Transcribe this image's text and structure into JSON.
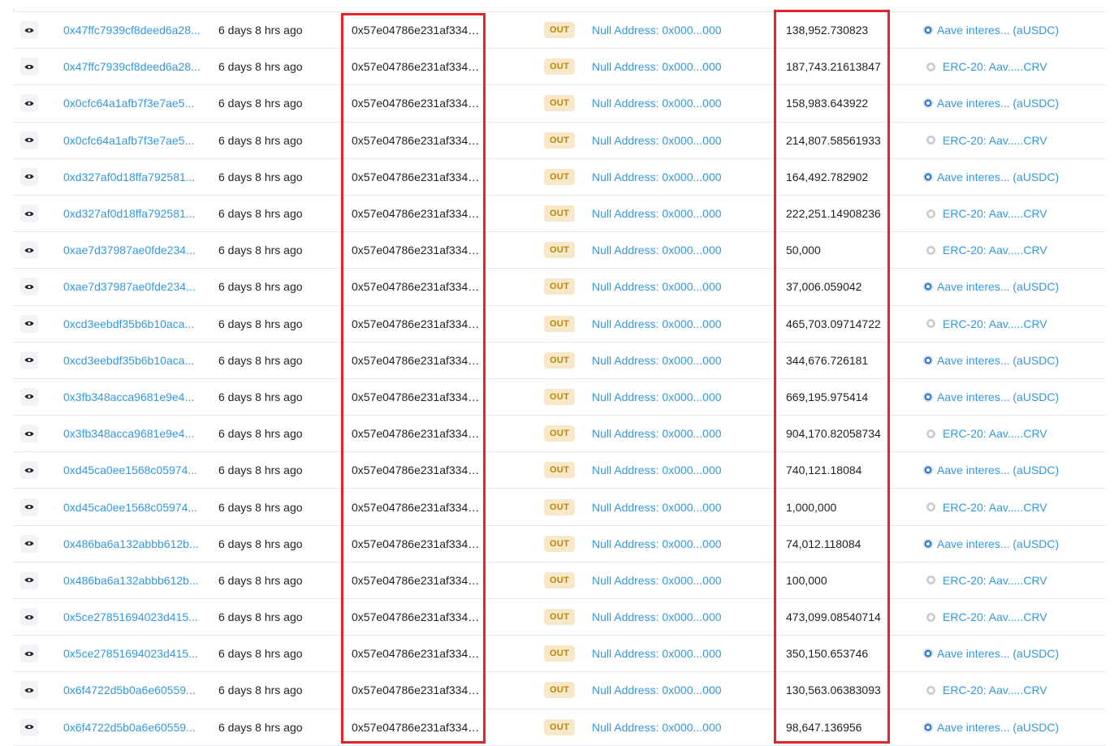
{
  "colors": {
    "link": "#3498db",
    "badge_bg": "#f8e8c8",
    "badge_text": "#b8860b",
    "highlight": "#e3242b",
    "row_border": "#e7eaf3"
  },
  "icons": {
    "view": "eye-icon",
    "token_ausdc": "ausdc-token-icon",
    "token_crv": "crv-token-icon"
  },
  "rows": [
    {
      "txn_hash": "0x47ffc7939cf8deed6a28...",
      "age": "6 days 8 hrs ago",
      "from": "0x57e04786e231af3343...",
      "direction": "OUT",
      "to": "Null Address: 0x000...000",
      "value": "138,952.730823",
      "token_type": "ausdc",
      "token": "Aave interes... (aUSDC)"
    },
    {
      "txn_hash": "0x47ffc7939cf8deed6a28...",
      "age": "6 days 8 hrs ago",
      "from": "0x57e04786e231af3343...",
      "direction": "OUT",
      "to": "Null Address: 0x000...000",
      "value": "187,743.21613847",
      "token_type": "crv",
      "token": "ERC-20: Aav.....CRV"
    },
    {
      "txn_hash": "0x0cfc64a1afb7f3e7ae5...",
      "age": "6 days 8 hrs ago",
      "from": "0x57e04786e231af3343...",
      "direction": "OUT",
      "to": "Null Address: 0x000...000",
      "value": "158,983.643922",
      "token_type": "ausdc",
      "token": "Aave interes... (aUSDC)"
    },
    {
      "txn_hash": "0x0cfc64a1afb7f3e7ae5...",
      "age": "6 days 8 hrs ago",
      "from": "0x57e04786e231af3343...",
      "direction": "OUT",
      "to": "Null Address: 0x000...000",
      "value": "214,807.58561933",
      "token_type": "crv",
      "token": "ERC-20: Aav.....CRV"
    },
    {
      "txn_hash": "0xd327af0d18ffa792581...",
      "age": "6 days 8 hrs ago",
      "from": "0x57e04786e231af3343...",
      "direction": "OUT",
      "to": "Null Address: 0x000...000",
      "value": "164,492.782902",
      "token_type": "ausdc",
      "token": "Aave interes... (aUSDC)"
    },
    {
      "txn_hash": "0xd327af0d18ffa792581...",
      "age": "6 days 8 hrs ago",
      "from": "0x57e04786e231af3343...",
      "direction": "OUT",
      "to": "Null Address: 0x000...000",
      "value": "222,251.14908236",
      "token_type": "crv",
      "token": "ERC-20: Aav.....CRV"
    },
    {
      "txn_hash": "0xae7d37987ae0fde234...",
      "age": "6 days 8 hrs ago",
      "from": "0x57e04786e231af3343...",
      "direction": "OUT",
      "to": "Null Address: 0x000...000",
      "value": "50,000",
      "token_type": "crv",
      "token": "ERC-20: Aav.....CRV"
    },
    {
      "txn_hash": "0xae7d37987ae0fde234...",
      "age": "6 days 8 hrs ago",
      "from": "0x57e04786e231af3343...",
      "direction": "OUT",
      "to": "Null Address: 0x000...000",
      "value": "37,006.059042",
      "token_type": "ausdc",
      "token": "Aave interes... (aUSDC)"
    },
    {
      "txn_hash": "0xcd3eebdf35b6b10aca...",
      "age": "6 days 8 hrs ago",
      "from": "0x57e04786e231af3343...",
      "direction": "OUT",
      "to": "Null Address: 0x000...000",
      "value": "465,703.09714722",
      "token_type": "crv",
      "token": "ERC-20: Aav.....CRV"
    },
    {
      "txn_hash": "0xcd3eebdf35b6b10aca...",
      "age": "6 days 8 hrs ago",
      "from": "0x57e04786e231af3343...",
      "direction": "OUT",
      "to": "Null Address: 0x000...000",
      "value": "344,676.726181",
      "token_type": "ausdc",
      "token": "Aave interes... (aUSDC)"
    },
    {
      "txn_hash": "0x3fb348acca9681e9e4...",
      "age": "6 days 8 hrs ago",
      "from": "0x57e04786e231af3343...",
      "direction": "OUT",
      "to": "Null Address: 0x000...000",
      "value": "669,195.975414",
      "token_type": "ausdc",
      "token": "Aave interes... (aUSDC)"
    },
    {
      "txn_hash": "0x3fb348acca9681e9e4...",
      "age": "6 days 8 hrs ago",
      "from": "0x57e04786e231af3343...",
      "direction": "OUT",
      "to": "Null Address: 0x000...000",
      "value": "904,170.82058734",
      "token_type": "crv",
      "token": "ERC-20: Aav.....CRV"
    },
    {
      "txn_hash": "0xd45ca0ee1568c05974...",
      "age": "6 days 8 hrs ago",
      "from": "0x57e04786e231af3343...",
      "direction": "OUT",
      "to": "Null Address: 0x000...000",
      "value": "740,121.18084",
      "token_type": "ausdc",
      "token": "Aave interes... (aUSDC)"
    },
    {
      "txn_hash": "0xd45ca0ee1568c05974...",
      "age": "6 days 8 hrs ago",
      "from": "0x57e04786e231af3343...",
      "direction": "OUT",
      "to": "Null Address: 0x000...000",
      "value": "1,000,000",
      "token_type": "crv",
      "token": "ERC-20: Aav.....CRV"
    },
    {
      "txn_hash": "0x486ba6a132abbb612b...",
      "age": "6 days 8 hrs ago",
      "from": "0x57e04786e231af3343...",
      "direction": "OUT",
      "to": "Null Address: 0x000...000",
      "value": "74,012.118084",
      "token_type": "ausdc",
      "token": "Aave interes... (aUSDC)"
    },
    {
      "txn_hash": "0x486ba6a132abbb612b...",
      "age": "6 days 8 hrs ago",
      "from": "0x57e04786e231af3343...",
      "direction": "OUT",
      "to": "Null Address: 0x000...000",
      "value": "100,000",
      "token_type": "crv",
      "token": "ERC-20: Aav.....CRV"
    },
    {
      "txn_hash": "0x5ce27851694023d415...",
      "age": "6 days 8 hrs ago",
      "from": "0x57e04786e231af3343...",
      "direction": "OUT",
      "to": "Null Address: 0x000...000",
      "value": "473,099.08540714",
      "token_type": "crv",
      "token": "ERC-20: Aav.....CRV"
    },
    {
      "txn_hash": "0x5ce27851694023d415...",
      "age": "6 days 8 hrs ago",
      "from": "0x57e04786e231af3343...",
      "direction": "OUT",
      "to": "Null Address: 0x000...000",
      "value": "350,150.653746",
      "token_type": "ausdc",
      "token": "Aave interes... (aUSDC)"
    },
    {
      "txn_hash": "0x6f4722d5b0a6e60559...",
      "age": "6 days 8 hrs ago",
      "from": "0x57e04786e231af3343...",
      "direction": "OUT",
      "to": "Null Address: 0x000...000",
      "value": "130,563.06383093",
      "token_type": "crv",
      "token": "ERC-20: Aav.....CRV"
    },
    {
      "txn_hash": "0x6f4722d5b0a6e60559...",
      "age": "6 days 8 hrs ago",
      "from": "0x57e04786e231af3343...",
      "direction": "OUT",
      "to": "Null Address: 0x000...000",
      "value": "98,647.136956",
      "token_type": "ausdc",
      "token": "Aave interes... (aUSDC)"
    }
  ]
}
